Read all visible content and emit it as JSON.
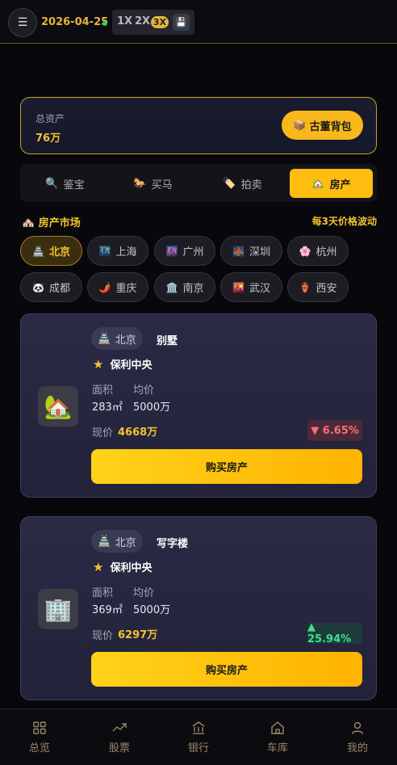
{
  "topbar": {
    "menu_icon": "hamburger-icon",
    "date": "2026-04-25",
    "speeds": [
      "1X",
      "2X",
      "3X"
    ],
    "active_speed": "3X",
    "save_icon": "floppy-disk-icon"
  },
  "assets": {
    "label": "总资产",
    "value": "76万",
    "antique_button": "古董背包",
    "antique_icon": "📦"
  },
  "tabs": [
    {
      "label": "鉴宝",
      "icon": "🔍"
    },
    {
      "label": "买马",
      "icon": "🐎"
    },
    {
      "label": "拍卖",
      "icon": "🏷️"
    },
    {
      "label": "房产",
      "icon": "🏡",
      "active": true
    }
  ],
  "market": {
    "title": "房产市场",
    "title_icon": "🏘️",
    "note": "每3天价格波动"
  },
  "cities": [
    {
      "name": "北京",
      "icon": "🏯",
      "active": true
    },
    {
      "name": "上海",
      "icon": "🌃"
    },
    {
      "name": "广州",
      "icon": "🌆"
    },
    {
      "name": "深圳",
      "icon": "🌉"
    },
    {
      "name": "杭州",
      "icon": "🌸"
    },
    {
      "name": "成都",
      "icon": "🐼"
    },
    {
      "name": "重庆",
      "icon": "🌶️"
    },
    {
      "name": "南京",
      "icon": "🏛️"
    },
    {
      "name": "武汉",
      "icon": "🌇"
    },
    {
      "name": "西安",
      "icon": "🏺"
    }
  ],
  "properties": [
    {
      "city": "北京",
      "city_icon": "🏯",
      "type": "别墅",
      "name": "保利中央",
      "thumb": "🏡",
      "area_label": "面积",
      "area": "283㎡",
      "avg_label": "均价",
      "avg": "5000万",
      "current_label": "现价",
      "current": "4668万",
      "change": "▼ 6.65%",
      "direction": "down",
      "buy": "购买房产"
    },
    {
      "city": "北京",
      "city_icon": "🏯",
      "type": "写字楼",
      "name": "保利中央",
      "thumb": "🏢",
      "area_label": "面积",
      "area": "369㎡",
      "avg_label": "均价",
      "avg": "5000万",
      "current_label": "现价",
      "current": "6297万",
      "change": "▲ 25.94%",
      "direction": "up",
      "buy": "购买房产"
    }
  ],
  "bottom_nav": [
    {
      "label": "总览",
      "icon": "grid-icon"
    },
    {
      "label": "股票",
      "icon": "trend-icon"
    },
    {
      "label": "银行",
      "icon": "bank-icon"
    },
    {
      "label": "车库",
      "icon": "house-icon"
    },
    {
      "label": "我的",
      "icon": "user-icon"
    }
  ]
}
